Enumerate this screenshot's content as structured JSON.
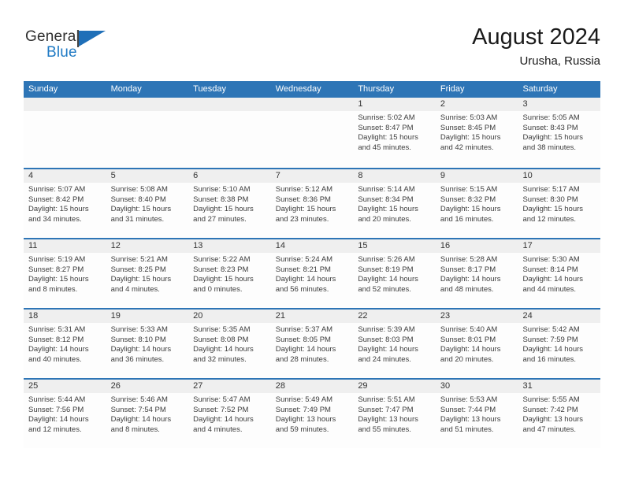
{
  "brand": {
    "name_part1": "General",
    "name_part2": "Blue",
    "accent_color": "#1f7ac4",
    "logo_icon": "flag-triangle-icon"
  },
  "header": {
    "title": "August 2024",
    "subtitle": "Urusha, Russia"
  },
  "theme": {
    "header_blue": "#2e75b6",
    "daynum_band": "#efefef",
    "cell_background": "#fdfdfd",
    "text_color": "#3c3c3c"
  },
  "weekday_headers": [
    "Sunday",
    "Monday",
    "Tuesday",
    "Wednesday",
    "Thursday",
    "Friday",
    "Saturday"
  ],
  "weeks": [
    [
      {
        "day": "",
        "sunrise": "",
        "sunset": "",
        "daylight_line1": "",
        "daylight_line2": "",
        "empty": true
      },
      {
        "day": "",
        "sunrise": "",
        "sunset": "",
        "daylight_line1": "",
        "daylight_line2": "",
        "empty": true
      },
      {
        "day": "",
        "sunrise": "",
        "sunset": "",
        "daylight_line1": "",
        "daylight_line2": "",
        "empty": true
      },
      {
        "day": "",
        "sunrise": "",
        "sunset": "",
        "daylight_line1": "",
        "daylight_line2": "",
        "empty": true
      },
      {
        "day": "1",
        "sunrise": "Sunrise: 5:02 AM",
        "sunset": "Sunset: 8:47 PM",
        "daylight_line1": "Daylight: 15 hours",
        "daylight_line2": "and 45 minutes."
      },
      {
        "day": "2",
        "sunrise": "Sunrise: 5:03 AM",
        "sunset": "Sunset: 8:45 PM",
        "daylight_line1": "Daylight: 15 hours",
        "daylight_line2": "and 42 minutes."
      },
      {
        "day": "3",
        "sunrise": "Sunrise: 5:05 AM",
        "sunset": "Sunset: 8:43 PM",
        "daylight_line1": "Daylight: 15 hours",
        "daylight_line2": "and 38 minutes."
      }
    ],
    [
      {
        "day": "4",
        "sunrise": "Sunrise: 5:07 AM",
        "sunset": "Sunset: 8:42 PM",
        "daylight_line1": "Daylight: 15 hours",
        "daylight_line2": "and 34 minutes."
      },
      {
        "day": "5",
        "sunrise": "Sunrise: 5:08 AM",
        "sunset": "Sunset: 8:40 PM",
        "daylight_line1": "Daylight: 15 hours",
        "daylight_line2": "and 31 minutes."
      },
      {
        "day": "6",
        "sunrise": "Sunrise: 5:10 AM",
        "sunset": "Sunset: 8:38 PM",
        "daylight_line1": "Daylight: 15 hours",
        "daylight_line2": "and 27 minutes."
      },
      {
        "day": "7",
        "sunrise": "Sunrise: 5:12 AM",
        "sunset": "Sunset: 8:36 PM",
        "daylight_line1": "Daylight: 15 hours",
        "daylight_line2": "and 23 minutes."
      },
      {
        "day": "8",
        "sunrise": "Sunrise: 5:14 AM",
        "sunset": "Sunset: 8:34 PM",
        "daylight_line1": "Daylight: 15 hours",
        "daylight_line2": "and 20 minutes."
      },
      {
        "day": "9",
        "sunrise": "Sunrise: 5:15 AM",
        "sunset": "Sunset: 8:32 PM",
        "daylight_line1": "Daylight: 15 hours",
        "daylight_line2": "and 16 minutes."
      },
      {
        "day": "10",
        "sunrise": "Sunrise: 5:17 AM",
        "sunset": "Sunset: 8:30 PM",
        "daylight_line1": "Daylight: 15 hours",
        "daylight_line2": "and 12 minutes."
      }
    ],
    [
      {
        "day": "11",
        "sunrise": "Sunrise: 5:19 AM",
        "sunset": "Sunset: 8:27 PM",
        "daylight_line1": "Daylight: 15 hours",
        "daylight_line2": "and 8 minutes."
      },
      {
        "day": "12",
        "sunrise": "Sunrise: 5:21 AM",
        "sunset": "Sunset: 8:25 PM",
        "daylight_line1": "Daylight: 15 hours",
        "daylight_line2": "and 4 minutes."
      },
      {
        "day": "13",
        "sunrise": "Sunrise: 5:22 AM",
        "sunset": "Sunset: 8:23 PM",
        "daylight_line1": "Daylight: 15 hours",
        "daylight_line2": "and 0 minutes."
      },
      {
        "day": "14",
        "sunrise": "Sunrise: 5:24 AM",
        "sunset": "Sunset: 8:21 PM",
        "daylight_line1": "Daylight: 14 hours",
        "daylight_line2": "and 56 minutes."
      },
      {
        "day": "15",
        "sunrise": "Sunrise: 5:26 AM",
        "sunset": "Sunset: 8:19 PM",
        "daylight_line1": "Daylight: 14 hours",
        "daylight_line2": "and 52 minutes."
      },
      {
        "day": "16",
        "sunrise": "Sunrise: 5:28 AM",
        "sunset": "Sunset: 8:17 PM",
        "daylight_line1": "Daylight: 14 hours",
        "daylight_line2": "and 48 minutes."
      },
      {
        "day": "17",
        "sunrise": "Sunrise: 5:30 AM",
        "sunset": "Sunset: 8:14 PM",
        "daylight_line1": "Daylight: 14 hours",
        "daylight_line2": "and 44 minutes."
      }
    ],
    [
      {
        "day": "18",
        "sunrise": "Sunrise: 5:31 AM",
        "sunset": "Sunset: 8:12 PM",
        "daylight_line1": "Daylight: 14 hours",
        "daylight_line2": "and 40 minutes."
      },
      {
        "day": "19",
        "sunrise": "Sunrise: 5:33 AM",
        "sunset": "Sunset: 8:10 PM",
        "daylight_line1": "Daylight: 14 hours",
        "daylight_line2": "and 36 minutes."
      },
      {
        "day": "20",
        "sunrise": "Sunrise: 5:35 AM",
        "sunset": "Sunset: 8:08 PM",
        "daylight_line1": "Daylight: 14 hours",
        "daylight_line2": "and 32 minutes."
      },
      {
        "day": "21",
        "sunrise": "Sunrise: 5:37 AM",
        "sunset": "Sunset: 8:05 PM",
        "daylight_line1": "Daylight: 14 hours",
        "daylight_line2": "and 28 minutes."
      },
      {
        "day": "22",
        "sunrise": "Sunrise: 5:39 AM",
        "sunset": "Sunset: 8:03 PM",
        "daylight_line1": "Daylight: 14 hours",
        "daylight_line2": "and 24 minutes."
      },
      {
        "day": "23",
        "sunrise": "Sunrise: 5:40 AM",
        "sunset": "Sunset: 8:01 PM",
        "daylight_line1": "Daylight: 14 hours",
        "daylight_line2": "and 20 minutes."
      },
      {
        "day": "24",
        "sunrise": "Sunrise: 5:42 AM",
        "sunset": "Sunset: 7:59 PM",
        "daylight_line1": "Daylight: 14 hours",
        "daylight_line2": "and 16 minutes."
      }
    ],
    [
      {
        "day": "25",
        "sunrise": "Sunrise: 5:44 AM",
        "sunset": "Sunset: 7:56 PM",
        "daylight_line1": "Daylight: 14 hours",
        "daylight_line2": "and 12 minutes."
      },
      {
        "day": "26",
        "sunrise": "Sunrise: 5:46 AM",
        "sunset": "Sunset: 7:54 PM",
        "daylight_line1": "Daylight: 14 hours",
        "daylight_line2": "and 8 minutes."
      },
      {
        "day": "27",
        "sunrise": "Sunrise: 5:47 AM",
        "sunset": "Sunset: 7:52 PM",
        "daylight_line1": "Daylight: 14 hours",
        "daylight_line2": "and 4 minutes."
      },
      {
        "day": "28",
        "sunrise": "Sunrise: 5:49 AM",
        "sunset": "Sunset: 7:49 PM",
        "daylight_line1": "Daylight: 13 hours",
        "daylight_line2": "and 59 minutes."
      },
      {
        "day": "29",
        "sunrise": "Sunrise: 5:51 AM",
        "sunset": "Sunset: 7:47 PM",
        "daylight_line1": "Daylight: 13 hours",
        "daylight_line2": "and 55 minutes."
      },
      {
        "day": "30",
        "sunrise": "Sunrise: 5:53 AM",
        "sunset": "Sunset: 7:44 PM",
        "daylight_line1": "Daylight: 13 hours",
        "daylight_line2": "and 51 minutes."
      },
      {
        "day": "31",
        "sunrise": "Sunrise: 5:55 AM",
        "sunset": "Sunset: 7:42 PM",
        "daylight_line1": "Daylight: 13 hours",
        "daylight_line2": "and 47 minutes."
      }
    ]
  ]
}
